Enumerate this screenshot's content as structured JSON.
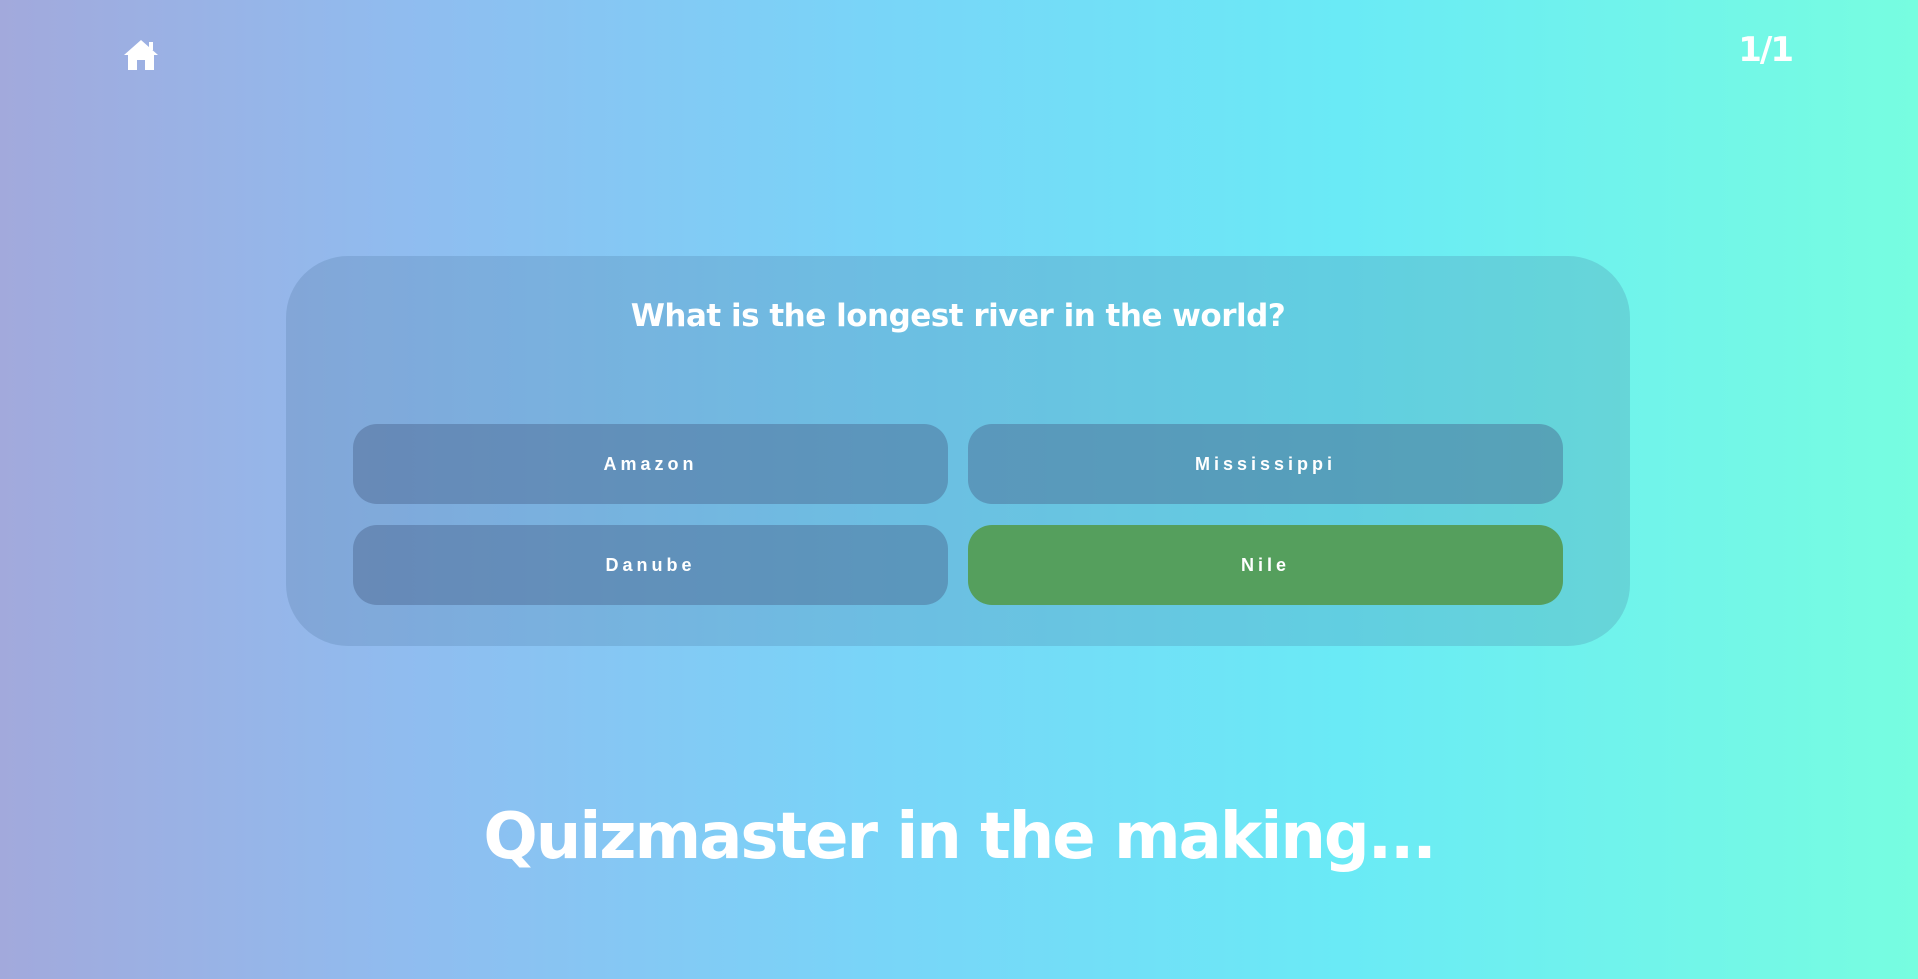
{
  "header": {
    "home_icon": "home-icon",
    "progress": "1/1"
  },
  "quiz": {
    "question": "What is the longest river in the world?",
    "answers": [
      {
        "label": "Amazon",
        "state": "neutral"
      },
      {
        "label": "Mississippi",
        "state": "neutral"
      },
      {
        "label": "Danube",
        "state": "neutral"
      },
      {
        "label": "Nile",
        "state": "correct"
      }
    ]
  },
  "result": {
    "message": "Quizmaster in the making..."
  },
  "colors": {
    "correct_answer": "#559f5d",
    "gradient_start": "#a2a9dc",
    "gradient_end": "#77fde0"
  }
}
